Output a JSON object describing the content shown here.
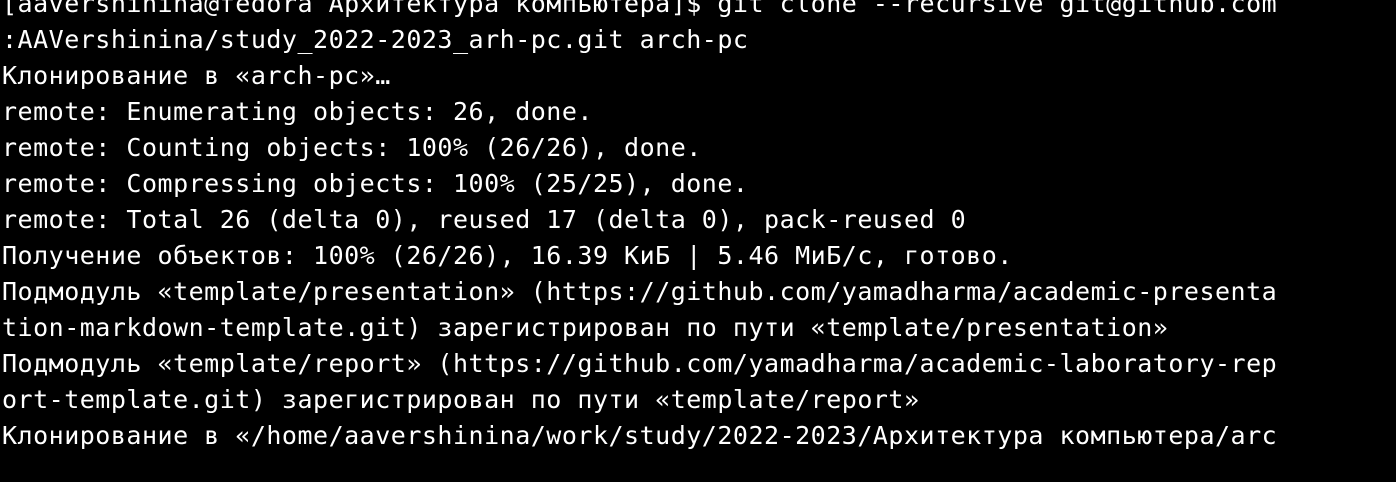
{
  "terminal": {
    "lines": [
      "[aavershinina@fedora Архитектура компьютера]$ git clone --recursive git@github.com",
      ":AAVershinina/study_2022-2023_arh-pc.git arch-pc",
      "Клонирование в «arch-pc»…",
      "remote: Enumerating objects: 26, done.",
      "remote: Counting objects: 100% (26/26), done.",
      "remote: Compressing objects: 100% (25/25), done.",
      "remote: Total 26 (delta 0), reused 17 (delta 0), pack-reused 0",
      "Получение объектов: 100% (26/26), 16.39 КиБ | 5.46 МиБ/с, готово.",
      "Подмодуль «template/presentation» (https://github.com/yamadharma/academic-presenta",
      "tion-markdown-template.git) зарегистрирован по пути «template/presentation»",
      "Подмодуль «template/report» (https://github.com/yamadharma/academic-laboratory-rep",
      "ort-template.git) зарегистрирован по пути «template/report»",
      "Клонирование в «/home/aavershinina/work/study/2022-2023/Архитектура компьютера/arc"
    ]
  },
  "colors": {
    "background": "#000000",
    "foreground": "#ffffff"
  }
}
